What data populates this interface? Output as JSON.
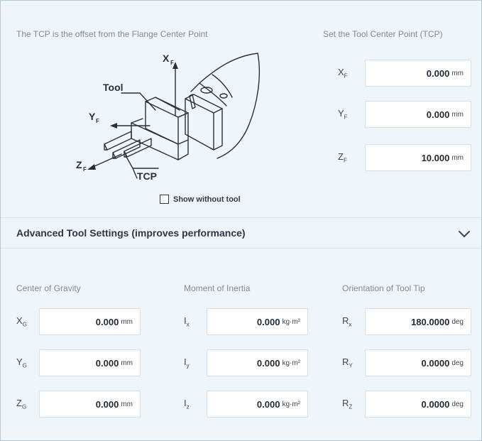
{
  "tcp_description": "The TCP is the offset from the Flange Center Point",
  "tcp_set_title": "Set the Tool Center Point (TCP)",
  "figure": {
    "tool_label": "Tool",
    "tcp_label": "TCP",
    "xf": "X",
    "yf": "Y",
    "zf": "Z",
    "sub_f": "F"
  },
  "show_without_tool": "Show without tool",
  "tcp_fields": [
    {
      "axis": "X",
      "sub": "F",
      "value": "0.000",
      "unit": "mm"
    },
    {
      "axis": "Y",
      "sub": "F",
      "value": "0.000",
      "unit": "mm"
    },
    {
      "axis": "Z",
      "sub": "F",
      "value": "10.000",
      "unit": "mm"
    }
  ],
  "advanced": {
    "title": "Advanced Tool Settings (improves performance)",
    "expand_icon": "chevron-down-icon",
    "center_of_gravity": {
      "title": "Center of Gravity",
      "rows": [
        {
          "axis": "X",
          "sub": "G",
          "value": "0.000",
          "unit": "mm"
        },
        {
          "axis": "Y",
          "sub": "G",
          "value": "0.000",
          "unit": "mm"
        },
        {
          "axis": "Z",
          "sub": "G",
          "value": "0.000",
          "unit": "mm"
        }
      ]
    },
    "moment_of_inertia": {
      "title": "Moment of Inertia",
      "rows": [
        {
          "axis": "I",
          "sub": "x",
          "value": "0.000",
          "unit": "kg·m²"
        },
        {
          "axis": "I",
          "sub": "y",
          "value": "0.000",
          "unit": "kg·m²"
        },
        {
          "axis": "I",
          "sub": "z",
          "value": "0.000",
          "unit": "kg·m²"
        }
      ]
    },
    "orientation": {
      "title": "Orientation of Tool Tip",
      "rows": [
        {
          "axis": "R",
          "sub": "x",
          "value": "180.0000",
          "unit": "deg"
        },
        {
          "axis": "R",
          "sub": "Y",
          "value": "0.0000",
          "unit": "deg"
        },
        {
          "axis": "R",
          "sub": "Z",
          "value": "0.0000",
          "unit": "deg"
        }
      ]
    }
  }
}
